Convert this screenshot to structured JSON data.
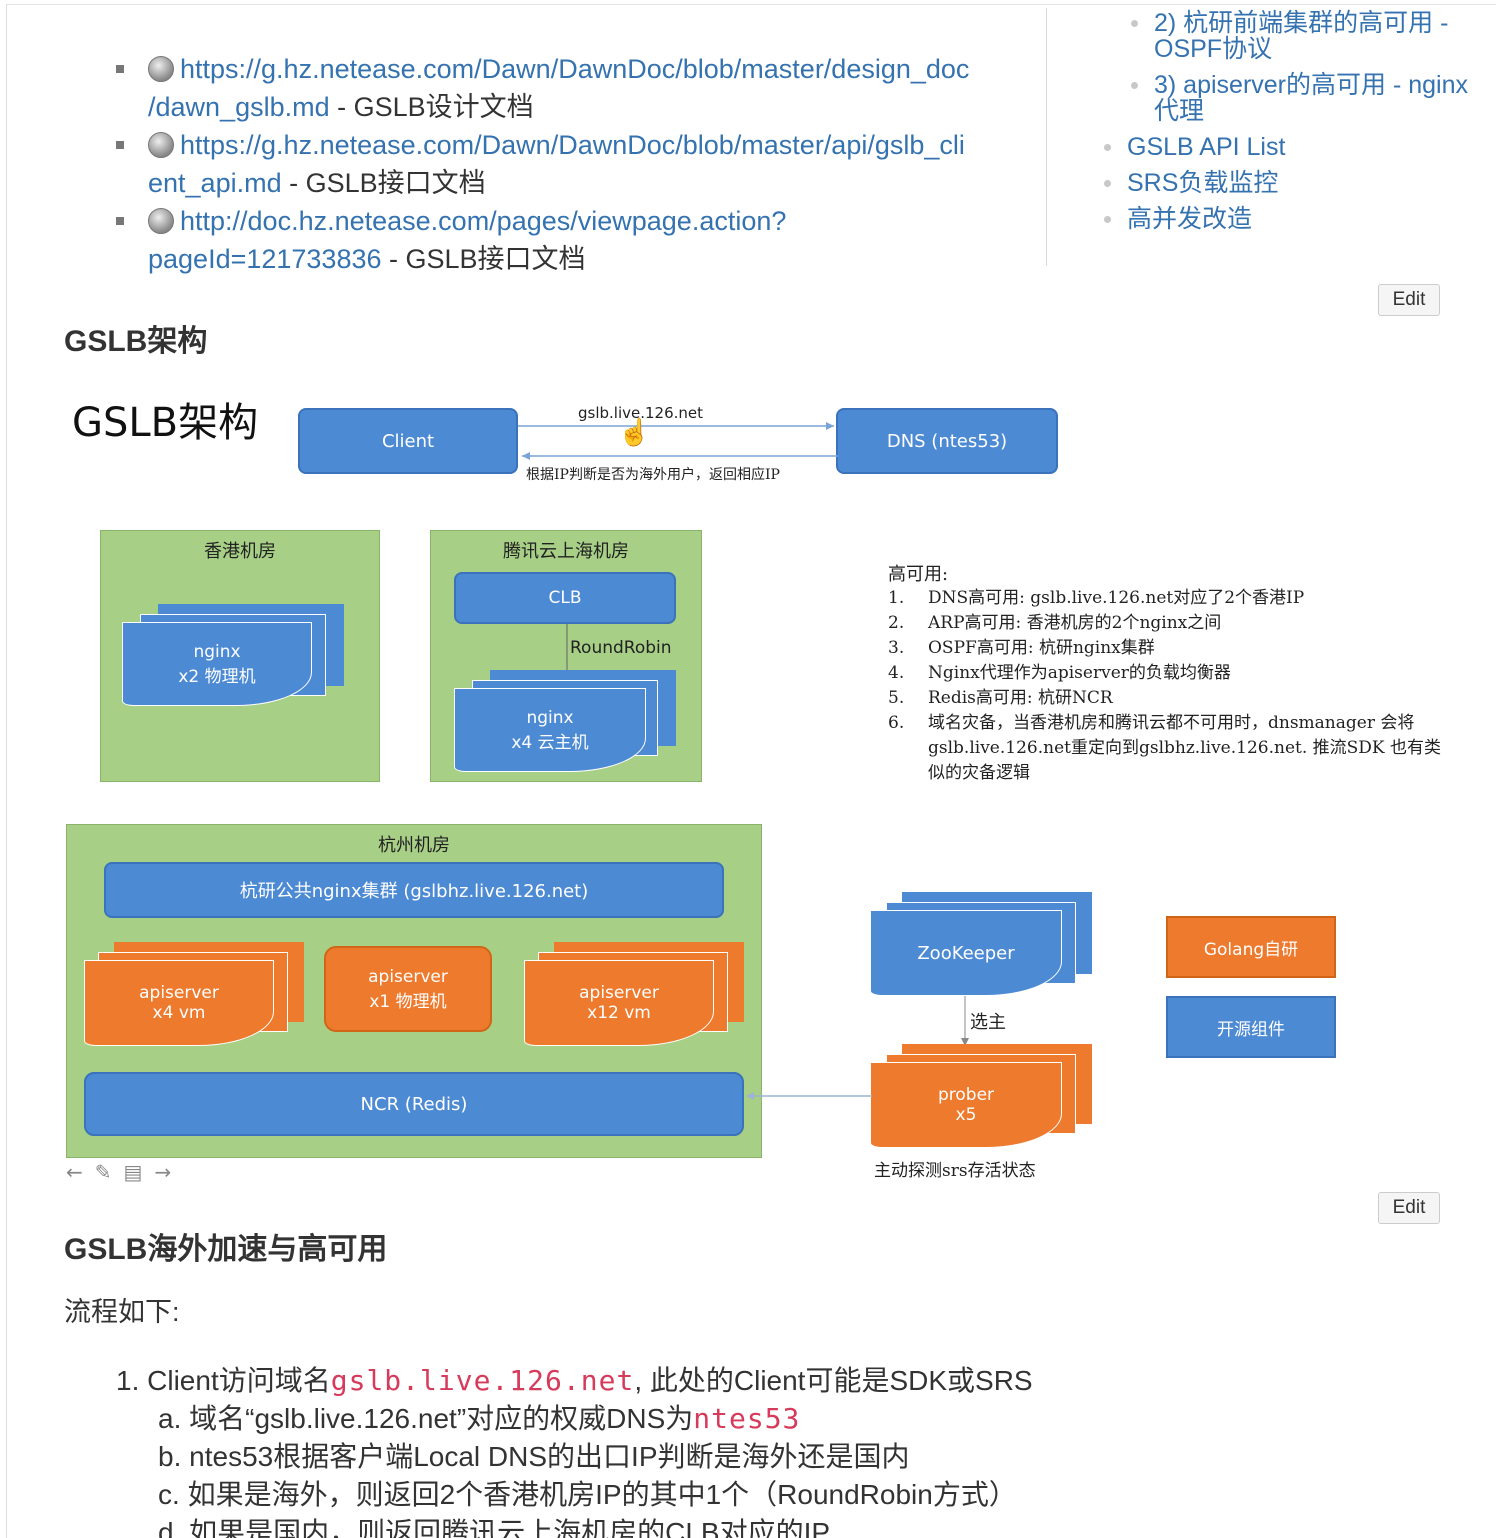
{
  "links": [
    {
      "url1": "https://g.hz.netease.com/Dawn/DawnDoc/blob/master/design_doc",
      "url2": "/dawn_gslb.md",
      "desc": " - GSLB设计文档"
    },
    {
      "url1": "https://g.hz.netease.com/Dawn/DawnDoc/blob/master/api/gslb_cli",
      "url2": "ent_api.md",
      "desc": " - GSLB接口文档"
    },
    {
      "url1": "http://doc.hz.netease.com/pages/viewpage.action?",
      "url2": "pageId=121733836",
      "desc": " - GSLB接口文档"
    }
  ],
  "toc": {
    "sub": [
      "2) 杭研前端集群的高可用 - OSPF协议",
      "3) apiserver的高可用 - nginx 代理"
    ],
    "items": [
      "GSLB API List",
      "SRS负载监控",
      "高并发改造"
    ]
  },
  "edit_label": "Edit",
  "section1": {
    "title": "GSLB架构"
  },
  "diagram": {
    "title": "GSLB架构",
    "client": "Client",
    "dns": "DNS (ntes53)",
    "arrow_top": "gslb.live.126.net",
    "arrow_bottom": "根据IP判断是否为海外用户，返回相应IP",
    "hk_room": "香港机房",
    "hk_nginx": "nginx\nx2 物理机",
    "tx_room": "腾讯云上海机房",
    "clb": "CLB",
    "roundrobin": "RoundRobin",
    "tx_nginx": "nginx\nx4 云主机",
    "ha_title": "高可用:",
    "ha_items": [
      "DNS高可用: gslb.live.126.net对应了2个香港IP",
      "ARP高可用: 香港机房的2个nginx之间",
      "OSPF高可用: 杭研nginx集群",
      "Nginx代理作为apiserver的负载均衡器",
      "Redis高可用: 杭研NCR",
      "域名灾备，当香港机房和腾讯云都不可用时，dnsmanager 会将gslb.live.126.net重定向到gslbhz.live.126.net. 推流SDK 也有类似的灾备逻辑"
    ],
    "hz_room": "杭州机房",
    "hz_nginx": "杭研公共nginx集群 (gslbhz.live.126.net)",
    "api1": "apiserver\nx4 vm",
    "api2": "apiserver\nx1 物理机",
    "api3": "apiserver\nx12 vm",
    "ncr": "NCR (Redis)",
    "zookeeper": "ZooKeeper",
    "elect": "选主",
    "prober": "prober\nx5",
    "probe_note": "主动探测srs存活状态",
    "legend_golang": "Golang自研",
    "legend_open": "开源组件"
  },
  "section2": {
    "title": "GSLB海外加速与高可用",
    "flow": "流程如下:"
  },
  "steps": {
    "s1_pre": "Client访问域名",
    "s1_code": "gslb.live.126.net",
    "s1_post": ", 此处的Client可能是SDK或SRS",
    "a_pre": "域名“gslb.live.126.net”对应的权威DNS为",
    "a_code": "ntes53",
    "b": "ntes53根据客户端Local DNS的出口IP判断是海外还是国内",
    "c": "如果是海外，则返回2个香港机房IP的其中1个（RoundRobin方式）",
    "d": "如果是国内，则返回腾讯云上海机房的CLB对应的IP"
  },
  "colors": {
    "link": "#3572b0",
    "blue": "#4d8ad4",
    "orange": "#ee7a2d",
    "green": "#a7cf86",
    "code": "#d63b5b"
  }
}
